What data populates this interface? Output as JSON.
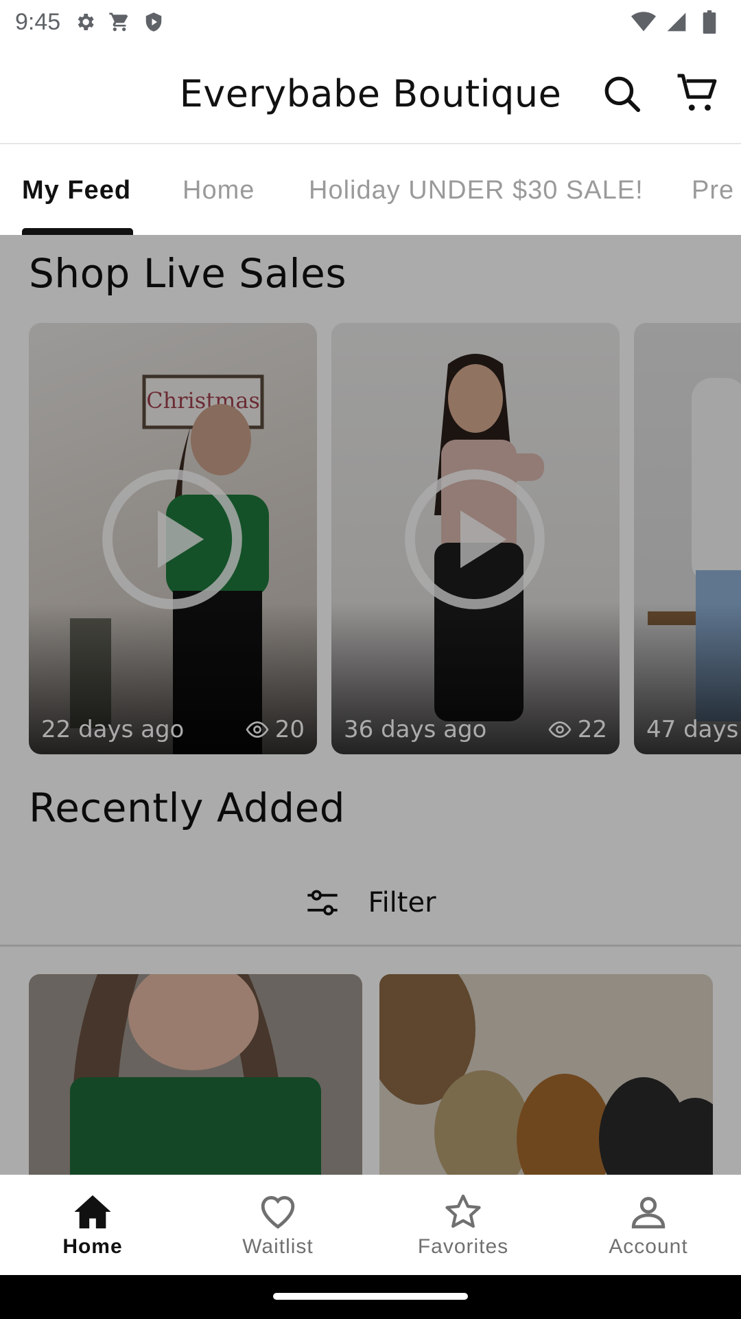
{
  "status_bar": {
    "time": "9:45",
    "left_icons": [
      "gear-icon",
      "cart-notification-icon",
      "shield-icon"
    ],
    "right_icons": [
      "wifi-icon",
      "signal-icon",
      "battery-icon"
    ]
  },
  "header": {
    "title": "Everybabe Boutique",
    "actions": [
      "search-icon",
      "cart-icon"
    ]
  },
  "tabs": [
    {
      "label": "My Feed",
      "active": true
    },
    {
      "label": "Home",
      "active": false
    },
    {
      "label": "Holiday UNDER $30 SALE!",
      "active": false
    },
    {
      "label": "Pre",
      "active": false
    }
  ],
  "live_sales": {
    "title": "Shop Live Sales",
    "videos": [
      {
        "age": "22 days ago",
        "views": "20"
      },
      {
        "age": "36 days ago",
        "views": "22"
      },
      {
        "age": "47 days",
        "views": ""
      }
    ]
  },
  "recently_added": {
    "title": "Recently Added",
    "filter_label": "Filter"
  },
  "bottom_nav": [
    {
      "label": "Home",
      "icon": "home-icon",
      "active": true
    },
    {
      "label": "Waitlist",
      "icon": "heart-icon",
      "active": false
    },
    {
      "label": "Favorites",
      "icon": "star-icon",
      "active": false
    },
    {
      "label": "Account",
      "icon": "person-icon",
      "active": false
    }
  ],
  "colors": {
    "accent": "#111111",
    "inactive": "#9a9a9a",
    "dim_overlay": "rgba(0,0,0,0.33)"
  }
}
